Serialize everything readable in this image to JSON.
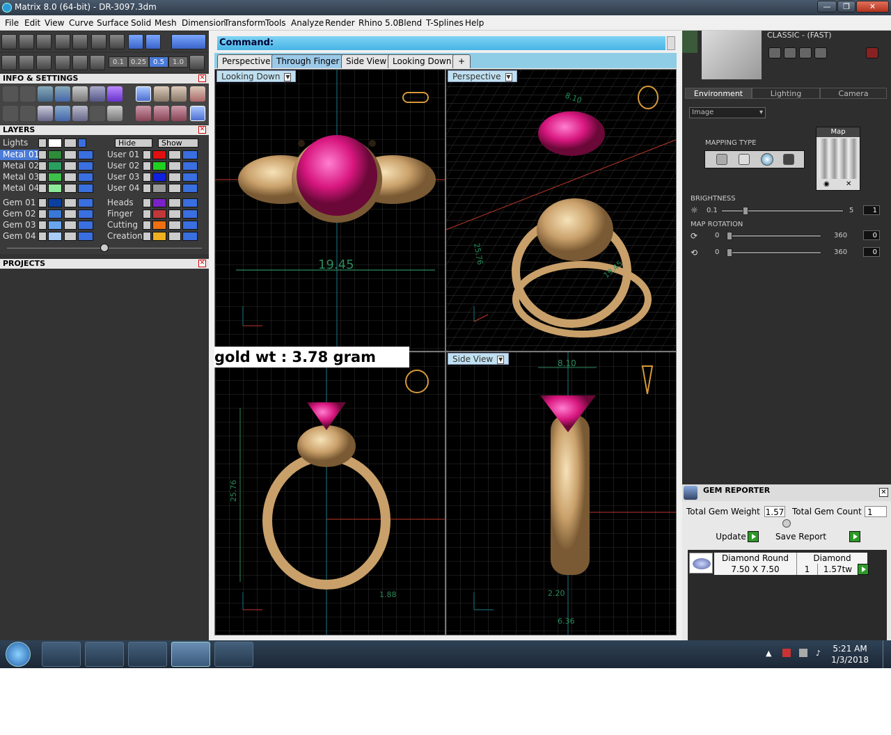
{
  "window": {
    "title": "Matrix 8.0 (64-bit) - DR-3097.3dm",
    "minimize": "—",
    "maximize": "❐",
    "close": "✕"
  },
  "menu": [
    "File",
    "Edit",
    "View",
    "Curve",
    "Surface",
    "Solid",
    "Mesh",
    "Dimension",
    "Transform",
    "Tools",
    "Analyze",
    "Render",
    "Rhino 5.0",
    "Blend",
    "T-Splines",
    "Help"
  ],
  "snap_values": [
    "0.1",
    "0.25",
    "0.5",
    "1.0"
  ],
  "info_settings": {
    "title": "INFO & SETTINGS"
  },
  "layers": {
    "title": "LAYERS",
    "lights_label": "Lights",
    "hide_label": "Hide",
    "show_label": "Show",
    "left": [
      {
        "name": "Metal 01",
        "color": "#2e8b3a",
        "selected": true
      },
      {
        "name": "Metal 02",
        "color": "#2aa060"
      },
      {
        "name": "Metal 03",
        "color": "#3ec04a"
      },
      {
        "name": "Metal 04",
        "color": "#8ee89a"
      },
      {
        "name": "Gem 01",
        "color": "#0b3fa0"
      },
      {
        "name": "Gem 02",
        "color": "#3a78d8"
      },
      {
        "name": "Gem 03",
        "color": "#6aa6ee"
      },
      {
        "name": "Gem 04",
        "color": "#a8ccf6"
      }
    ],
    "right": [
      {
        "name": "User 01",
        "color": "#e01010"
      },
      {
        "name": "User 02",
        "color": "#20d020"
      },
      {
        "name": "User 03",
        "color": "#1020e0"
      },
      {
        "name": "User 04",
        "color": "#9a9a9a"
      },
      {
        "name": "Heads",
        "color": "#7a22c8"
      },
      {
        "name": "Finger",
        "color": "#c03838"
      },
      {
        "name": "Cutting",
        "color": "#f07010"
      },
      {
        "name": "Creation",
        "color": "#f0b020"
      }
    ]
  },
  "projects": {
    "title": "PROJECTS"
  },
  "command": {
    "label": "Command:"
  },
  "view_tabs": [
    "Perspective",
    "Through Finger",
    "Side View",
    "Looking Down",
    "+"
  ],
  "viewports": {
    "top_left": {
      "label": "Looking Down",
      "dimension": "19.45"
    },
    "top_right": {
      "label": "Perspective",
      "dim1": "8.10",
      "dim2": "19.45",
      "dim3": "25.76"
    },
    "bottom_left": {
      "dim1": "25.76",
      "dim2": "1.88"
    },
    "bottom_right": {
      "label": "Side View",
      "dim1": "8.10",
      "dim2": "2.20",
      "dim3": "6.36"
    }
  },
  "annotation": {
    "gold_weight": "gold wt : 3.78 gram"
  },
  "render": {
    "preset": "CLASSIC - (FAST)",
    "tabs": [
      "Environment",
      "Lighting",
      "Camera"
    ],
    "env_dropdown": "Image",
    "mapping_type_label": "MAPPING TYPE",
    "map_label": "Map",
    "brightness": {
      "label": "BRIGHTNESS",
      "min": "0.1",
      "max": "5",
      "value": "1"
    },
    "map_rotation": {
      "label": "MAP ROTATION",
      "rows": [
        {
          "min": "0",
          "max": "360",
          "value": "0"
        },
        {
          "min": "0",
          "max": "360",
          "value": "0"
        }
      ]
    }
  },
  "gem_reporter": {
    "title": "GEM REPORTER",
    "total_weight_label": "Total Gem Weight",
    "total_weight": "1.57",
    "total_count_label": "Total Gem Count",
    "total_count": "1",
    "update_label": "Update",
    "save_label": "Save Report",
    "gem": {
      "cut": "Diamond Round",
      "size": "7.50 X 7.50",
      "type": "Diamond",
      "count": "1",
      "weight": "1.57tw"
    }
  },
  "taskbar": {
    "time": "5:21 AM",
    "date": "1/3/2018",
    "tray_arrow": "▲"
  }
}
